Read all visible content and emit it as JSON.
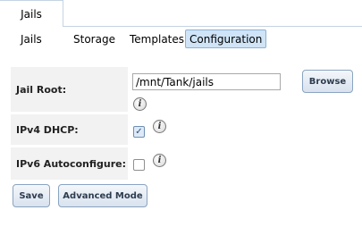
{
  "top_tab": {
    "label": "Jails"
  },
  "subtabs": [
    {
      "label": "Jails"
    },
    {
      "label": "Storage"
    },
    {
      "label": "Templates"
    },
    {
      "label": "Configuration"
    }
  ],
  "form": {
    "jail_root": {
      "label": "Jail Root:",
      "value": "/mnt/Tank/jails"
    },
    "ipv4_dhcp": {
      "label": "IPv4 DHCP:",
      "checked": true
    },
    "ipv6_autoconfigure": {
      "label": "IPv6 Autoconfigure:",
      "checked": false
    }
  },
  "buttons": {
    "browse": "Browse",
    "save": "Save",
    "advanced_mode": "Advanced Mode"
  },
  "icons": {
    "info": "i",
    "check": "✓"
  }
}
